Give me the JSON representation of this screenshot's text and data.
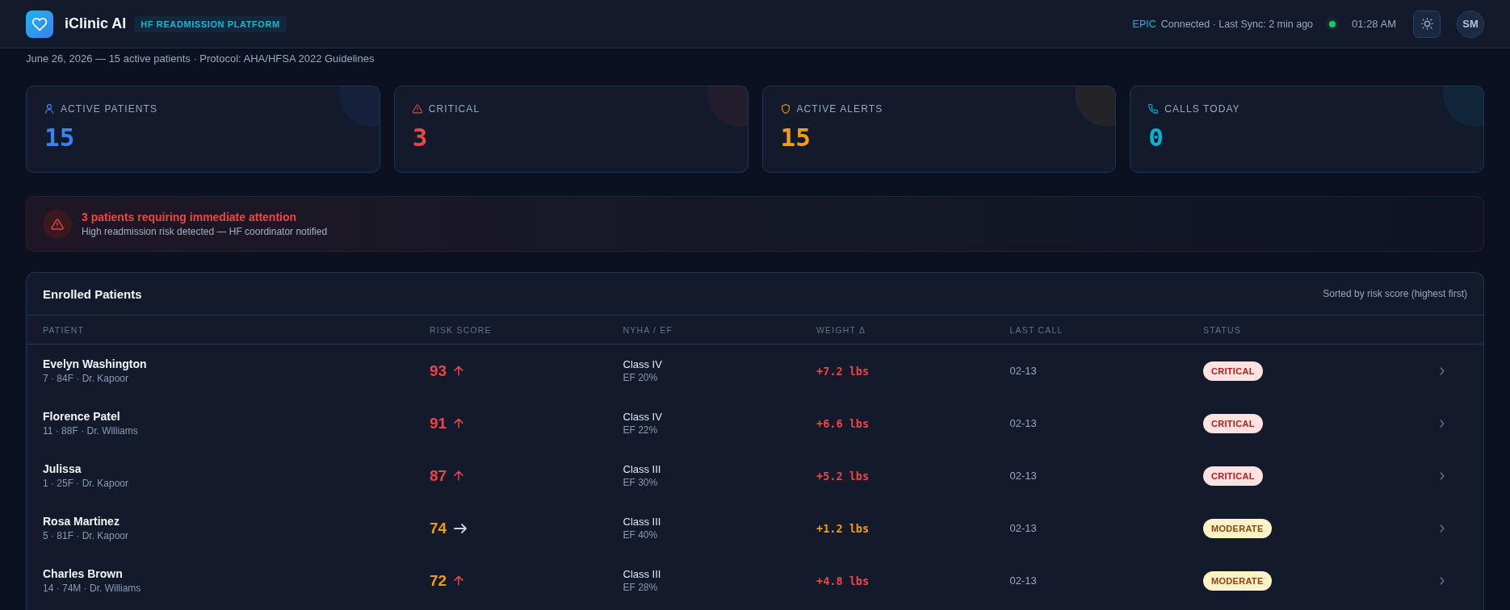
{
  "header": {
    "app_name": "iClinic AI",
    "badge": "HF READMISSION PLATFORM",
    "ehr": "EPIC",
    "sync": "Connected · Last Sync: 2 min ago",
    "connected": true,
    "time": "01:28 AM",
    "avatar": "SM"
  },
  "subtitle": "June 26, 2026 — 15 active patients · Protocol: AHA/HFSA 2022 Guidelines",
  "stats": [
    {
      "kind": "patients",
      "label": "ACTIVE PATIENTS",
      "value": "15",
      "color": "#3b82f6"
    },
    {
      "kind": "critical",
      "label": "CRITICAL",
      "value": "3",
      "color": "#ef4444"
    },
    {
      "kind": "alerts",
      "label": "ACTIVE ALERTS",
      "value": "15",
      "color": "#f59e0b"
    },
    {
      "kind": "calls",
      "label": "CALLS TODAY",
      "value": "0",
      "color": "#06b6d4"
    }
  ],
  "alert": {
    "title": "3 patients requiring immediate attention",
    "message": "High readmission risk detected — HF coordinator notified"
  },
  "table": {
    "title": "Enrolled Patients",
    "sort_note": "Sorted by risk score (highest first)",
    "columns": [
      "PATIENT",
      "RISK SCORE",
      "NYHA / EF",
      "WEIGHT Δ",
      "LAST CALL",
      "STATUS"
    ],
    "rows": [
      {
        "name": "Evelyn Washington",
        "details": "7 · 84F · Dr. Kapoor",
        "risk_score": "93",
        "rising": true,
        "nyha": "Class IV",
        "ef": "EF 20%",
        "weight": "+7.2 lbs",
        "weight_critical": true,
        "last_call": "02-13",
        "status": {
          "label": "CRITICAL",
          "kind": "critical"
        }
      },
      {
        "name": "Florence Patel",
        "details": "11 · 88F · Dr. Williams",
        "risk_score": "91",
        "rising": true,
        "nyha": "Class IV",
        "ef": "EF 22%",
        "weight": "+6.6 lbs",
        "weight_critical": true,
        "last_call": "02-13",
        "status": {
          "label": "CRITICAL",
          "kind": "critical"
        }
      },
      {
        "name": "Julissa",
        "details": "1 · 25F · Dr. Kapoor",
        "risk_score": "87",
        "rising": true,
        "nyha": "Class III",
        "ef": "EF 30%",
        "weight": "+5.2 lbs",
        "weight_critical": true,
        "last_call": "02-13",
        "status": {
          "label": "CRITICAL",
          "kind": "critical"
        }
      },
      {
        "name": "Rosa Martinez",
        "details": "5 · 81F · Dr. Kapoor",
        "risk_score": "74",
        "rising": false,
        "nyha": "Class III",
        "ef": "EF 40%",
        "weight": "+1.2 lbs",
        "weight_critical": false,
        "last_call": "02-13",
        "status": {
          "label": "MODERATE",
          "kind": "moderate"
        }
      },
      {
        "name": "Charles Brown",
        "details": "14 · 74M · Dr. Williams",
        "risk_score": "72",
        "rising": true,
        "nyha": "Class III",
        "ef": "EF 28%",
        "weight": "+4.8 lbs",
        "weight_critical": true,
        "last_call": "02-13",
        "status": {
          "label": "MODERATE",
          "kind": "moderate"
        }
      }
    ]
  }
}
